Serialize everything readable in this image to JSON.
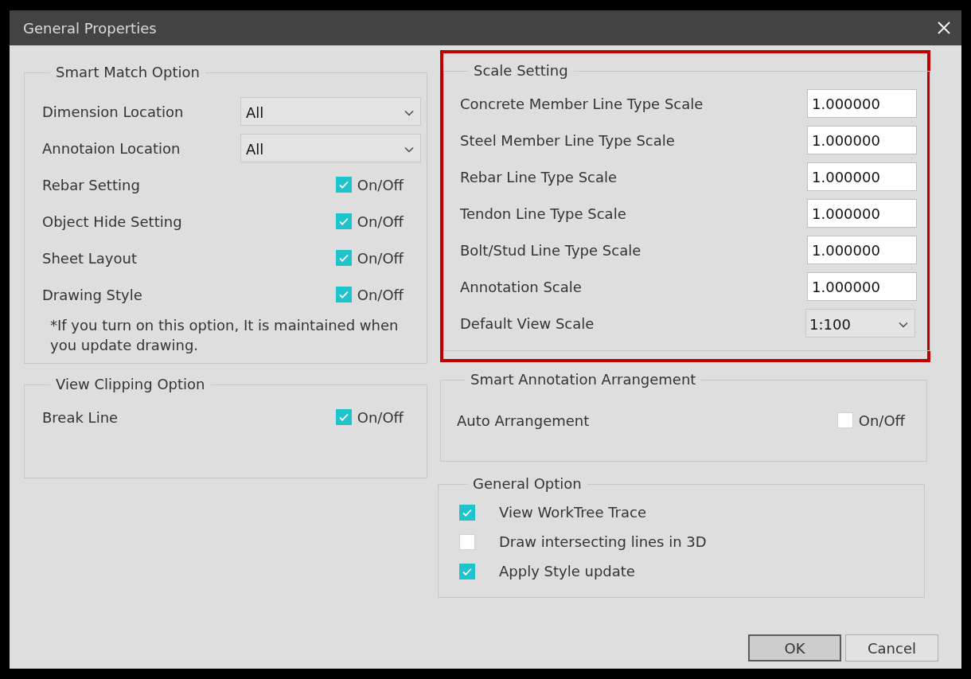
{
  "window": {
    "title": "General Properties"
  },
  "smart_match": {
    "title": "Smart Match Option",
    "rows": [
      {
        "kind": "dropdown",
        "label": "Dimension Location",
        "value": "All"
      },
      {
        "kind": "dropdown",
        "label": "Annotaion Location",
        "value": "All"
      },
      {
        "kind": "toggle",
        "label": "Rebar Setting",
        "checked": true,
        "toggle_label": "On/Off"
      },
      {
        "kind": "toggle",
        "label": "Object Hide Setting",
        "checked": true,
        "toggle_label": "On/Off"
      },
      {
        "kind": "toggle",
        "label": "Sheet Layout",
        "checked": true,
        "toggle_label": "On/Off"
      },
      {
        "kind": "toggle",
        "label": "Drawing Style",
        "checked": true,
        "toggle_label": "On/Off"
      }
    ],
    "note": "*If you turn on this option, It is maintained when you update drawing."
  },
  "view_clipping": {
    "title": "View Clipping Option",
    "rows": [
      {
        "kind": "toggle",
        "label": "Break Line",
        "checked": true,
        "toggle_label": "On/Off"
      }
    ]
  },
  "scale_setting": {
    "title": "Scale Setting",
    "highlighted": true,
    "rows": [
      {
        "kind": "input",
        "label": "Concrete Member Line Type Scale",
        "value": "1.000000"
      },
      {
        "kind": "input",
        "label": "Steel Member Line Type Scale",
        "value": "1.000000"
      },
      {
        "kind": "input",
        "label": "Rebar Line Type Scale",
        "value": "1.000000"
      },
      {
        "kind": "input",
        "label": "Tendon Line Type Scale",
        "value": "1.000000"
      },
      {
        "kind": "input",
        "label": "Bolt/Stud Line Type Scale",
        "value": "1.000000"
      },
      {
        "kind": "input",
        "label": "Annotation Scale",
        "value": "1.000000"
      },
      {
        "kind": "dropdown",
        "label": "Default View Scale",
        "value": "1:100"
      }
    ]
  },
  "smart_annotation": {
    "title": "Smart Annotation Arrangement",
    "rows": [
      {
        "kind": "toggle",
        "label": "Auto Arrangement",
        "checked": false,
        "toggle_label": "On/Off"
      }
    ]
  },
  "general_option": {
    "title": "General Option",
    "items": [
      {
        "label": "View WorkTree Trace",
        "checked": true
      },
      {
        "label": "Draw intersecting lines in 3D",
        "checked": false
      },
      {
        "label": "Apply Style update",
        "checked": true
      }
    ]
  },
  "buttons": [
    {
      "label": "OK",
      "default": true
    },
    {
      "label": "Cancel",
      "default": false
    }
  ]
}
